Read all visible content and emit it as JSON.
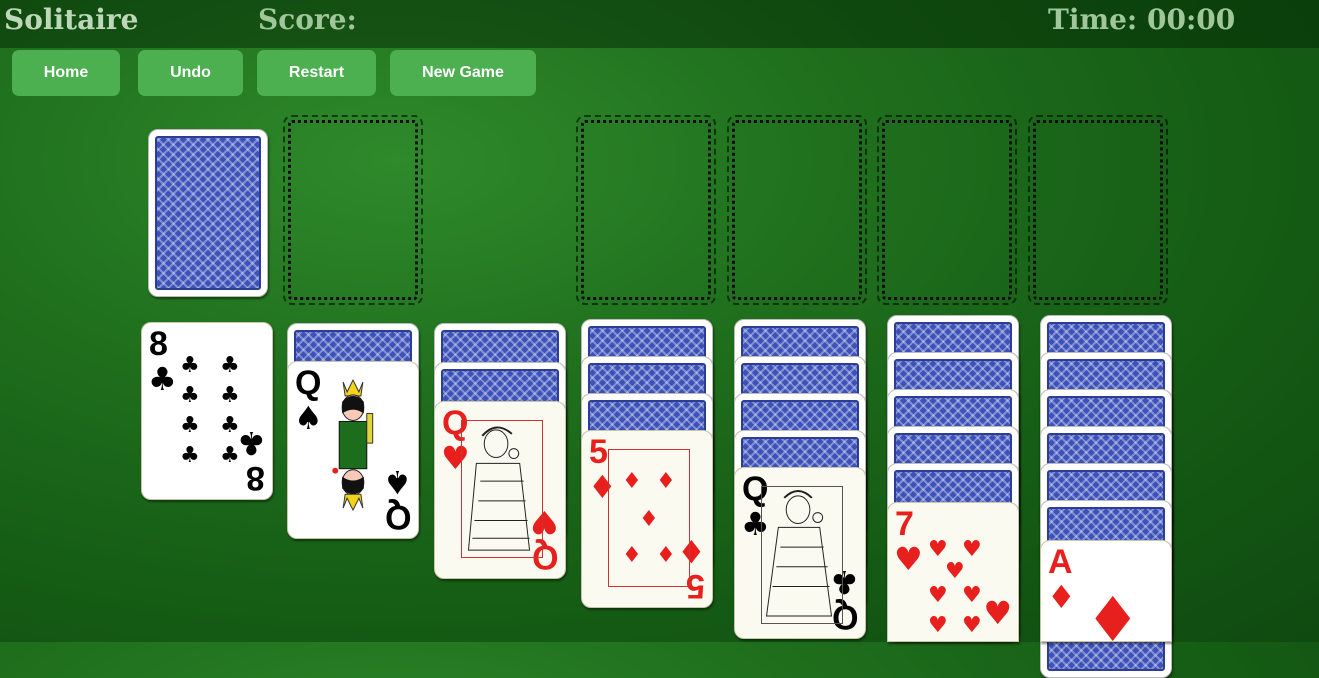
{
  "header": {
    "title": "Solitaire",
    "score_label": "Score:",
    "time_label": "Time: 00:00"
  },
  "buttons": {
    "home": "Home",
    "undo": "Undo",
    "restart": "Restart",
    "new_game": "New Game"
  },
  "stock": {
    "face_down_cards": 1
  },
  "foundations": {
    "count": 4,
    "cards": []
  },
  "tableau": [
    {
      "hidden": 0,
      "top": {
        "rank": "8",
        "suit": "♣",
        "color": "black"
      }
    },
    {
      "hidden": 1,
      "top": {
        "rank": "Q",
        "suit": "♠",
        "color": "black"
      }
    },
    {
      "hidden": 2,
      "top": {
        "rank": "Q",
        "suit": "♥",
        "color": "red"
      }
    },
    {
      "hidden": 3,
      "top": {
        "rank": "5",
        "suit": "♦",
        "color": "red"
      }
    },
    {
      "hidden": 4,
      "top": {
        "rank": "Q",
        "suit": "♣",
        "color": "black"
      }
    },
    {
      "hidden": 5,
      "top": {
        "rank": "7",
        "suit": "♥",
        "color": "red"
      }
    },
    {
      "hidden": 6,
      "top": {
        "rank": "A",
        "suit": "♦",
        "color": "red"
      }
    }
  ],
  "colors": {
    "table_green": "#1f6f1d",
    "button_green": "#4caf50",
    "card_back_blue": "#3d52b8",
    "suit_red": "#e8201d"
  }
}
